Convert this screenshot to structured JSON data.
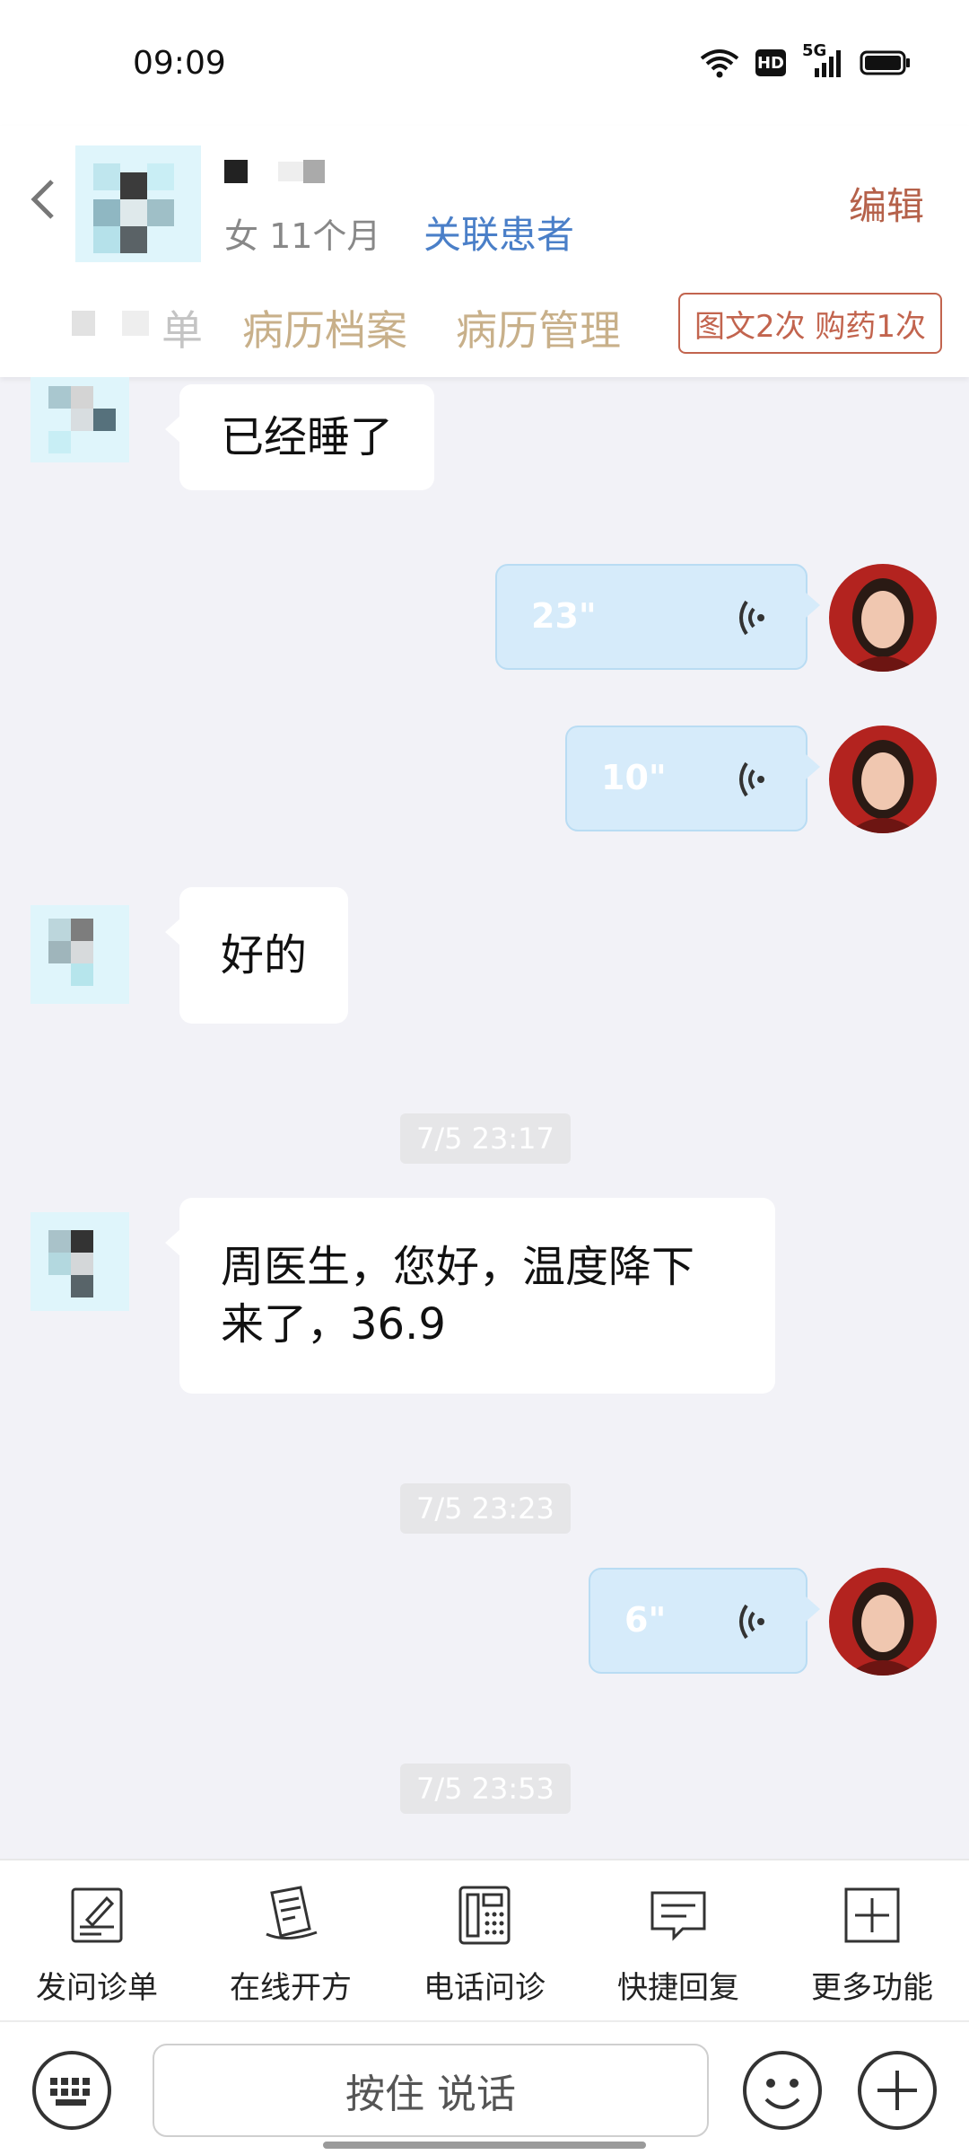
{
  "status_bar": {
    "time": "09:09",
    "network": "5G",
    "hd_label": "HD"
  },
  "header": {
    "patient_info": "女 11个月",
    "relate_link": "关联患者",
    "edit_label": "编辑",
    "tabs": [
      "单",
      "病历档案",
      "病历管理"
    ],
    "quota_badge": "图文2次 购药1次"
  },
  "messages": [
    {
      "side": "left",
      "type": "text",
      "text": "已经睡了"
    },
    {
      "side": "right",
      "type": "voice",
      "duration": "23\""
    },
    {
      "side": "right",
      "type": "voice",
      "duration": "10\""
    },
    {
      "side": "left",
      "type": "text",
      "text": "好的"
    },
    {
      "type": "time",
      "text": "7/5 23:17"
    },
    {
      "side": "left",
      "type": "text",
      "text": "周医生，您好，温度降下来了，36.9"
    },
    {
      "type": "time",
      "text": "7/5 23:23"
    },
    {
      "side": "right",
      "type": "voice",
      "duration": "6\""
    },
    {
      "type": "time",
      "text": "7/5 23:53"
    }
  ],
  "toolbar": {
    "items": [
      {
        "label": "发问诊单",
        "icon": "form-pen-icon"
      },
      {
        "label": "在线开方",
        "icon": "prescription-icon"
      },
      {
        "label": "电话问诊",
        "icon": "phone-icon"
      },
      {
        "label": "快捷回复",
        "icon": "chat-bubble-icon"
      },
      {
        "label": "更多功能",
        "icon": "plus-box-icon"
      }
    ]
  },
  "input": {
    "hold_to_talk": "按住 说话"
  },
  "colors": {
    "accent_link": "#4a7fc8",
    "edit": "#b5614a",
    "tab_text": "#c8b08a",
    "badge": "#c2644e",
    "voice_bubble": "#d6ebfa",
    "chat_bg": "#f2f2f7"
  }
}
